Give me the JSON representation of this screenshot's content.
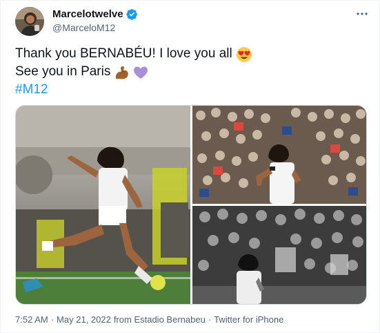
{
  "author": {
    "display_name": "Marcelotwelve",
    "handle": "@MarceloM12",
    "verified": true
  },
  "tweet": {
    "line1": "Thank you BERNABÉU! I love you all",
    "line1_emoji": "heart-eyes-emoji",
    "line2": "See you in Paris",
    "line2_emojis": [
      "flexed-biceps-emoji",
      "purple-heart-emoji"
    ],
    "hashtag": "#M12"
  },
  "media": {
    "photos": [
      {
        "name": "photo-kick",
        "style": "color"
      },
      {
        "name": "photo-crowd-color",
        "style": "color"
      },
      {
        "name": "photo-crowd-bw",
        "style": "black-and-white"
      }
    ]
  },
  "meta": {
    "time": "7:52 AM",
    "date": "May 21, 2022",
    "location": "from Estadio Bernabeu",
    "source": "Twitter for iPhone",
    "sep": "·"
  },
  "colors": {
    "accent": "#1d9bf0",
    "text": "#0f1419",
    "secondary": "#536471",
    "border": "#cfd9de"
  }
}
